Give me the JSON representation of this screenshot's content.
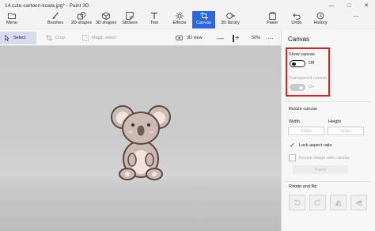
{
  "window": {
    "title": "14.cute-cartoon-koala.jpg* - Paint 3D",
    "controls": [
      "minimize-icon",
      "maximize-icon",
      "close-icon"
    ]
  },
  "ribbon": {
    "items": [
      {
        "id": "menu",
        "label": "Menu",
        "icon": "folder-icon"
      },
      {
        "id": "brushes",
        "label": "Brushes",
        "icon": "brush-icon"
      },
      {
        "id": "2d-shapes",
        "label": "2D shapes",
        "icon": "2d-shapes-icon"
      },
      {
        "id": "3d-shapes",
        "label": "3D shapes",
        "icon": "3d-shapes-icon"
      },
      {
        "id": "stickers",
        "label": "Stickers",
        "icon": "sticker-icon"
      },
      {
        "id": "text",
        "label": "Text",
        "icon": "text-icon"
      },
      {
        "id": "effects",
        "label": "Effects",
        "icon": "effects-icon"
      },
      {
        "id": "canvas",
        "label": "Canvas",
        "icon": "canvas-icon",
        "active": true
      },
      {
        "id": "3d-library",
        "label": "3D library",
        "icon": "3d-library-icon"
      },
      {
        "id": "paste",
        "label": "Paste",
        "icon": "paste-icon"
      },
      {
        "id": "undo",
        "label": "Undo",
        "icon": "undo-icon"
      },
      {
        "id": "history",
        "label": "History",
        "icon": "history-icon"
      },
      {
        "id": "more",
        "label": "",
        "icon": "more-icon"
      }
    ],
    "accent": "#2b67e3"
  },
  "toolbar": {
    "select_label": "Select",
    "crop_label": "Crop",
    "magic_select_label": "Magic select",
    "view_3d_label": "3D view",
    "zoom_value": "50%"
  },
  "panel": {
    "title": "Canvas",
    "show_canvas_label": "Show canvas",
    "show_canvas_state": "Off",
    "transparent_canvas_label": "Transparent canvas",
    "transparent_canvas_state": "On",
    "resize_canvas_label": "Resize canvas",
    "width_label": "Width",
    "height_label": "Height",
    "width_value": "612px",
    "height_value": "612px",
    "lock_aspect_label": "Lock aspect ratio",
    "lock_aspect_checked": true,
    "resize_image_label": "Resize image with canvas",
    "resize_image_checked": false,
    "units_value": "Pixels",
    "rotate_flip_label": "Rotate and flip",
    "highlight_color": "#d62323"
  },
  "canvas": {
    "image_subject": "cartoon-koala",
    "background_color": "#cacaca"
  }
}
